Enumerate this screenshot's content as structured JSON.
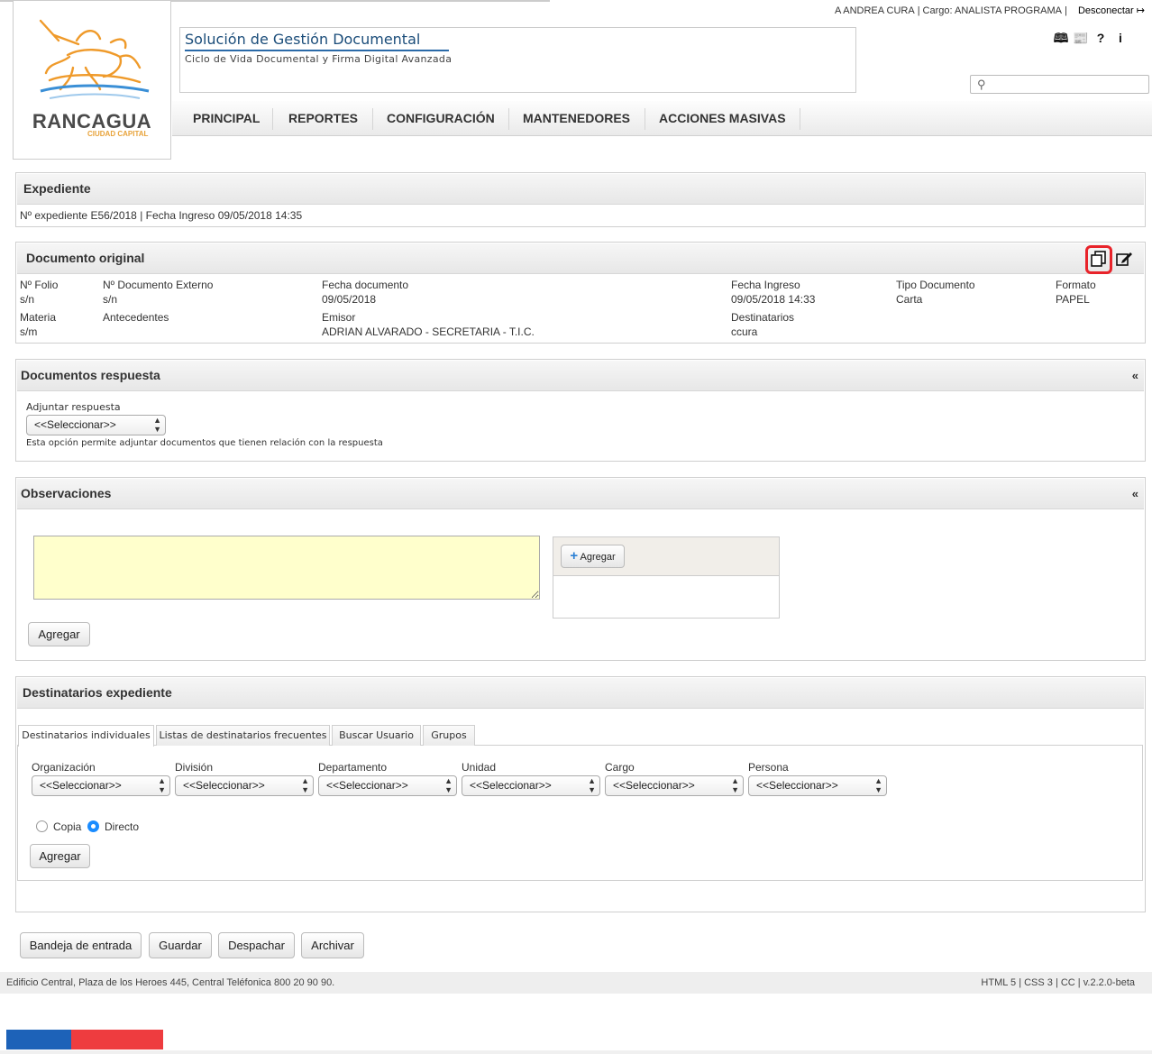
{
  "header": {
    "user_prefix": "A ANDREA CURA",
    "cargo_label": "Cargo:",
    "cargo_value": "ANALISTA PROGRAMA",
    "logout_label": "Desconectar",
    "app_title": "Solución de Gestión Documental",
    "app_subtitle": "Ciclo de Vida Documental y Firma Digital Avanzada",
    "logo_text": "RANCAGUA",
    "logo_subtext": "CIUDAD CAPITAL",
    "search_placeholder": "",
    "top_icons": [
      "book-icon",
      "newspaper-icon",
      "help-icon",
      "info-icon"
    ]
  },
  "nav": {
    "items": [
      "PRINCIPAL",
      "REPORTES",
      "CONFIGURACIÓN",
      "MANTENEDORES",
      "ACCIONES MASIVAS"
    ]
  },
  "expediente": {
    "title": "Expediente",
    "numero_label": "Nº expediente",
    "numero_value": "E56/2018",
    "fecha_label": "Fecha Ingreso",
    "fecha_value": "09/05/2018 14:35"
  },
  "documento": {
    "title": "Documento original",
    "folio_label": "Nº Folio",
    "folio_value": "s/n",
    "doc_ext_label": "Nº Documento Externo",
    "doc_ext_value": "s/n",
    "fecha_doc_label": "Fecha documento",
    "fecha_doc_value": "09/05/2018",
    "fecha_ing_label": "Fecha Ingreso",
    "fecha_ing_value": "09/05/2018 14:33",
    "tipo_label": "Tipo Documento",
    "tipo_value": "Carta",
    "formato_label": "Formato",
    "formato_value": "PAPEL",
    "materia_label": "Materia",
    "materia_value": "s/m",
    "antecedentes_label": "Antecedentes",
    "emisor_label": "Emisor",
    "emisor_value": "ADRIAN ALVARADO - SECRETARIA - T.I.C.",
    "destinatarios_label": "Destinatarios",
    "destinatarios_value": "ccura"
  },
  "respuesta": {
    "title": "Documentos respuesta",
    "adjuntar_label": "Adjuntar respuesta",
    "select_value": "<<Seleccionar>>",
    "help": "Esta opción permite adjuntar documentos que tienen relación con la respuesta"
  },
  "observaciones": {
    "title": "Observaciones",
    "textarea_value": "",
    "agregar_small": "Agregar",
    "agregar_button": "Agregar"
  },
  "destinatarios": {
    "title": "Destinatarios expediente",
    "tabs": [
      "Destinatarios individuales",
      "Listas de destinatarios frecuentes",
      "Buscar Usuario",
      "Grupos"
    ],
    "fields": [
      {
        "label": "Organización",
        "value": "<<Seleccionar>>"
      },
      {
        "label": "División",
        "value": "<<Seleccionar>>"
      },
      {
        "label": "Departamento",
        "value": "<<Seleccionar>>"
      },
      {
        "label": "Unidad",
        "value": "<<Seleccionar>>"
      },
      {
        "label": "Cargo",
        "value": "<<Seleccionar>>"
      },
      {
        "label": "Persona",
        "value": "<<Seleccionar>>"
      }
    ],
    "radio_copia": "Copia",
    "radio_directo": "Directo",
    "selected_radio": "Directo",
    "agregar_button": "Agregar"
  },
  "actions": [
    "Bandeja de entrada",
    "Guardar",
    "Despachar",
    "Archivar"
  ],
  "footer": {
    "left": "Edificio Central, Plaza de los Heroes 445, Central Teléfonica 800 20 90 90.",
    "right": "HTML 5 | CSS 3 | CC | v.2.2.0-beta"
  },
  "colors": {
    "brand_blue": "#1b4d7a",
    "highlight_red": "#e8232a",
    "textarea_bg": "#ffffcc",
    "flag_blue": "#1d62b8",
    "flag_red": "#ee3c3f",
    "radio_selected": "#1a8cff"
  }
}
